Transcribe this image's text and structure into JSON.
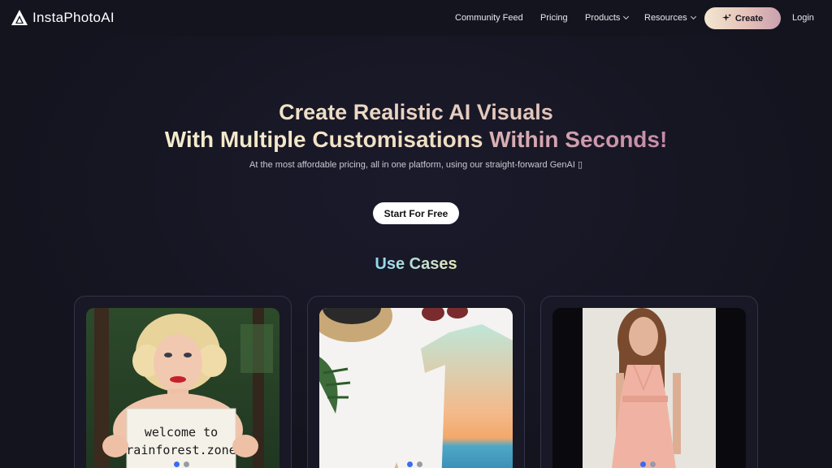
{
  "header": {
    "logo_text": "InstaPhotoAI",
    "nav": {
      "community_feed": "Community Feed",
      "pricing": "Pricing",
      "products": "Products",
      "resources": "Resources",
      "create": "Create",
      "login": "Login"
    }
  },
  "hero": {
    "line1": "Create Realistic AI Visuals",
    "line2_part1": "With Multiple Customisations",
    "line2_part2": "Within Seconds!",
    "subtitle": "At the most affordable pricing, all in one platform, using our straight-forward GenAI ▯",
    "cta": "Start For Free"
  },
  "use_cases": {
    "title": "Use Cases",
    "cards": [
      {
        "sign_line1": "welcome to",
        "sign_line2": "rainforest.zone"
      },
      {},
      {}
    ]
  },
  "colors": {
    "background": "#14141f",
    "carousel_dot_active": "#3b6cf0",
    "carousel_dot_inactive": "#9a9aa4"
  }
}
